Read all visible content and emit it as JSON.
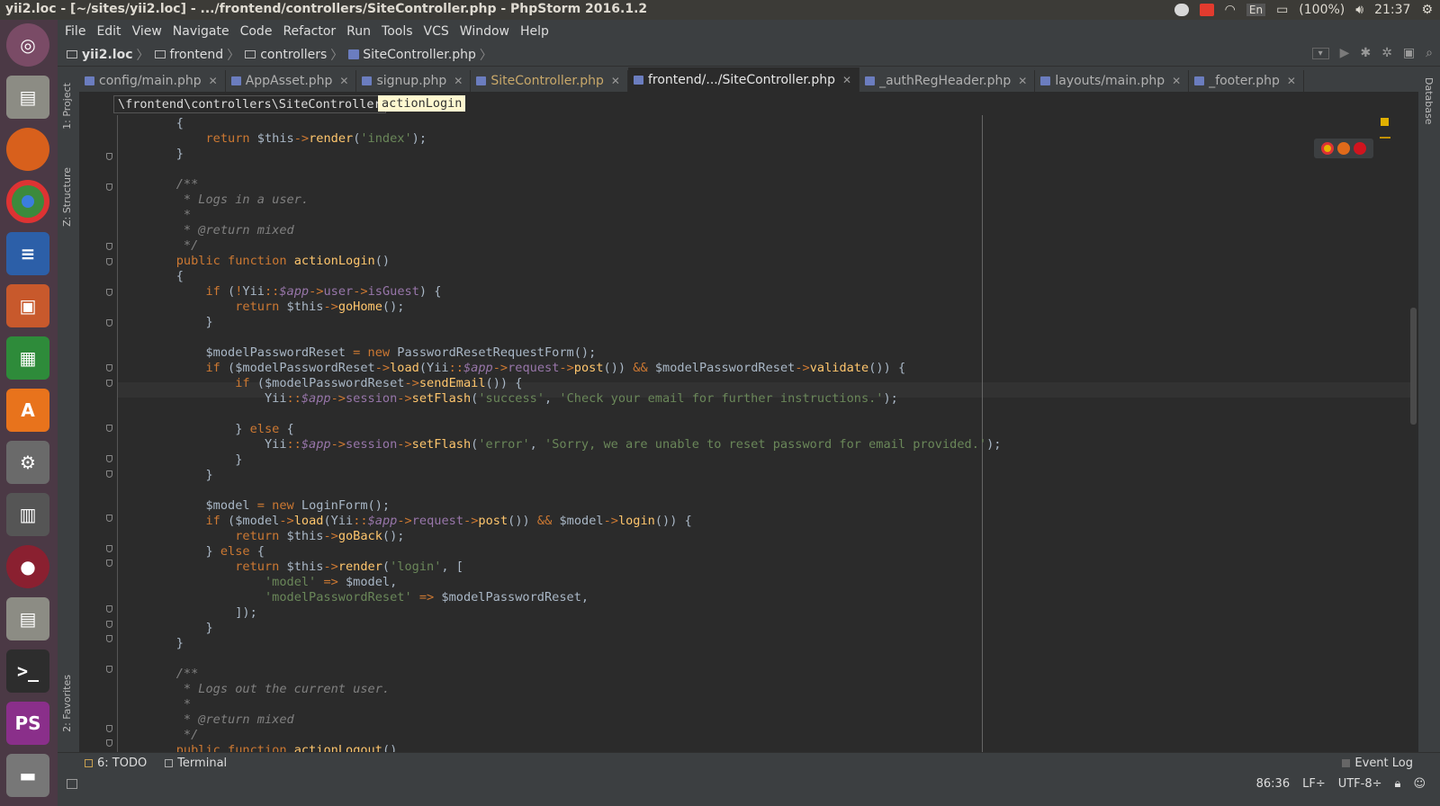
{
  "window": {
    "title": "yii2.loc - [~/sites/yii2.loc] - .../frontend/controllers/SiteController.php - PhpStorm 2016.1.2",
    "tray": {
      "battery": "(100%)",
      "keyboard": "En",
      "time": "21:37"
    }
  },
  "launcher": {
    "items": [
      "Ubuntu Dash",
      "Files",
      "Firefox",
      "Chrome",
      "LibreOffice Writer",
      "LibreOffice Impress",
      "LibreOffice Calc",
      "Ubuntu Software Center",
      "System Settings",
      "Workspace Switcher",
      "Screen Recorder",
      "Files",
      "Terminal",
      "PhpStorm",
      "Trash"
    ],
    "ps_label": "PS"
  },
  "menu": [
    "File",
    "Edit",
    "View",
    "Navigate",
    "Code",
    "Refactor",
    "Run",
    "Tools",
    "VCS",
    "Window",
    "Help"
  ],
  "breadcrumbs": [
    "yii2.loc",
    "frontend",
    "controllers",
    "SiteController.php"
  ],
  "tabs": [
    {
      "label": "config/main.php",
      "active": false
    },
    {
      "label": "AppAsset.php",
      "active": false
    },
    {
      "label": "signup.php",
      "active": false
    },
    {
      "label": "SiteController.php",
      "active": false
    },
    {
      "label": "frontend/.../SiteController.php",
      "active": true
    },
    {
      "label": "_authRegHeader.php",
      "active": false
    },
    {
      "label": "layouts/main.php",
      "active": false
    },
    {
      "label": "_footer.php",
      "active": false
    }
  ],
  "side_tabs": {
    "left": [
      "1: Project",
      "Z: Structure",
      "2: Favorites"
    ],
    "right": [
      "Database"
    ]
  },
  "editor_crumbs": {
    "namespace": "\\frontend\\controllers\\SiteController",
    "method": "actionLogin"
  },
  "code_lines": [
    "    {",
    "        return $this->render('index');",
    "    }",
    "",
    "    /**",
    "     * Logs in a user.",
    "     *",
    "     * @return mixed",
    "     */",
    "    public function actionLogin()",
    "    {",
    "        if (!Yii::$app->user->isGuest) {",
    "            return $this->goHome();",
    "        }",
    "",
    "        $modelPasswordReset = new PasswordResetRequestForm();",
    "        if ($modelPasswordReset->load(Yii::$app->request->post()) && $modelPasswordReset->validate()) {",
    "            if ($modelPasswordReset->sendEmail()) {",
    "                Yii::$app->session->setFlash('success', 'Check your email for further instructions.');",
    "",
    "            } else {",
    "                Yii::$app->session->setFlash('error', 'Sorry, we are unable to reset password for email provided.');",
    "            }",
    "        }",
    "",
    "        $model = new LoginForm();",
    "        if ($model->load(Yii::$app->request->post()) && $model->login()) {",
    "            return $this->goBack();",
    "        } else {",
    "            return $this->render('login', [",
    "                'model' => $model,",
    "                'modelPasswordReset' => $modelPasswordReset,",
    "            ]);",
    "        }",
    "    }",
    "",
    "    /**",
    "     * Logs out the current user.",
    "     *",
    "     * @return mixed",
    "     */",
    "    public function actionLogout()",
    "    {"
  ],
  "tool_windows": {
    "todo": "6: TODO",
    "terminal": "Terminal",
    "event_log": "Event Log"
  },
  "status": {
    "position": "86:36",
    "line_sep": "LF÷",
    "encoding": "UTF-8÷"
  },
  "colors": {
    "keyword": "#cc7832",
    "string": "#6a8759",
    "comment": "#808080",
    "function": "#ffc66d",
    "variable": "#9876aa",
    "background": "#2b2b2b"
  }
}
